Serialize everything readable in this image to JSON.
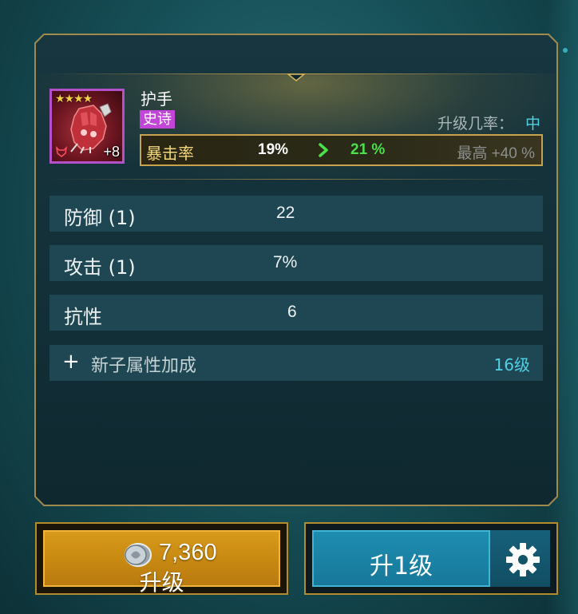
{
  "item": {
    "name": "护手",
    "rarity": "史诗",
    "stars": "★★★★",
    "plus_level": "+8",
    "rarity_color": "#c145d6"
  },
  "upgrade_chance": {
    "label": "升级几率：",
    "value": "中"
  },
  "main_stat": {
    "name": "暴击率",
    "current": "19%",
    "next": "21 %",
    "max": "最高 +40 %"
  },
  "substats": [
    {
      "label": "防御 (1)",
      "value": "22"
    },
    {
      "label": "攻击 (1)",
      "value": "7%"
    },
    {
      "label": "抗性",
      "value": "6"
    }
  ],
  "new_substat": {
    "plus": "+",
    "label": "新子属性加成",
    "level_req": "16级"
  },
  "buttons": {
    "upgrade_cost": "7,360",
    "upgrade_label": "升级",
    "level_up_label": "升1级"
  },
  "icons": {
    "coin": "silver-coin-icon",
    "settings": "gear-icon",
    "arrow": "chevron-right-icon"
  }
}
